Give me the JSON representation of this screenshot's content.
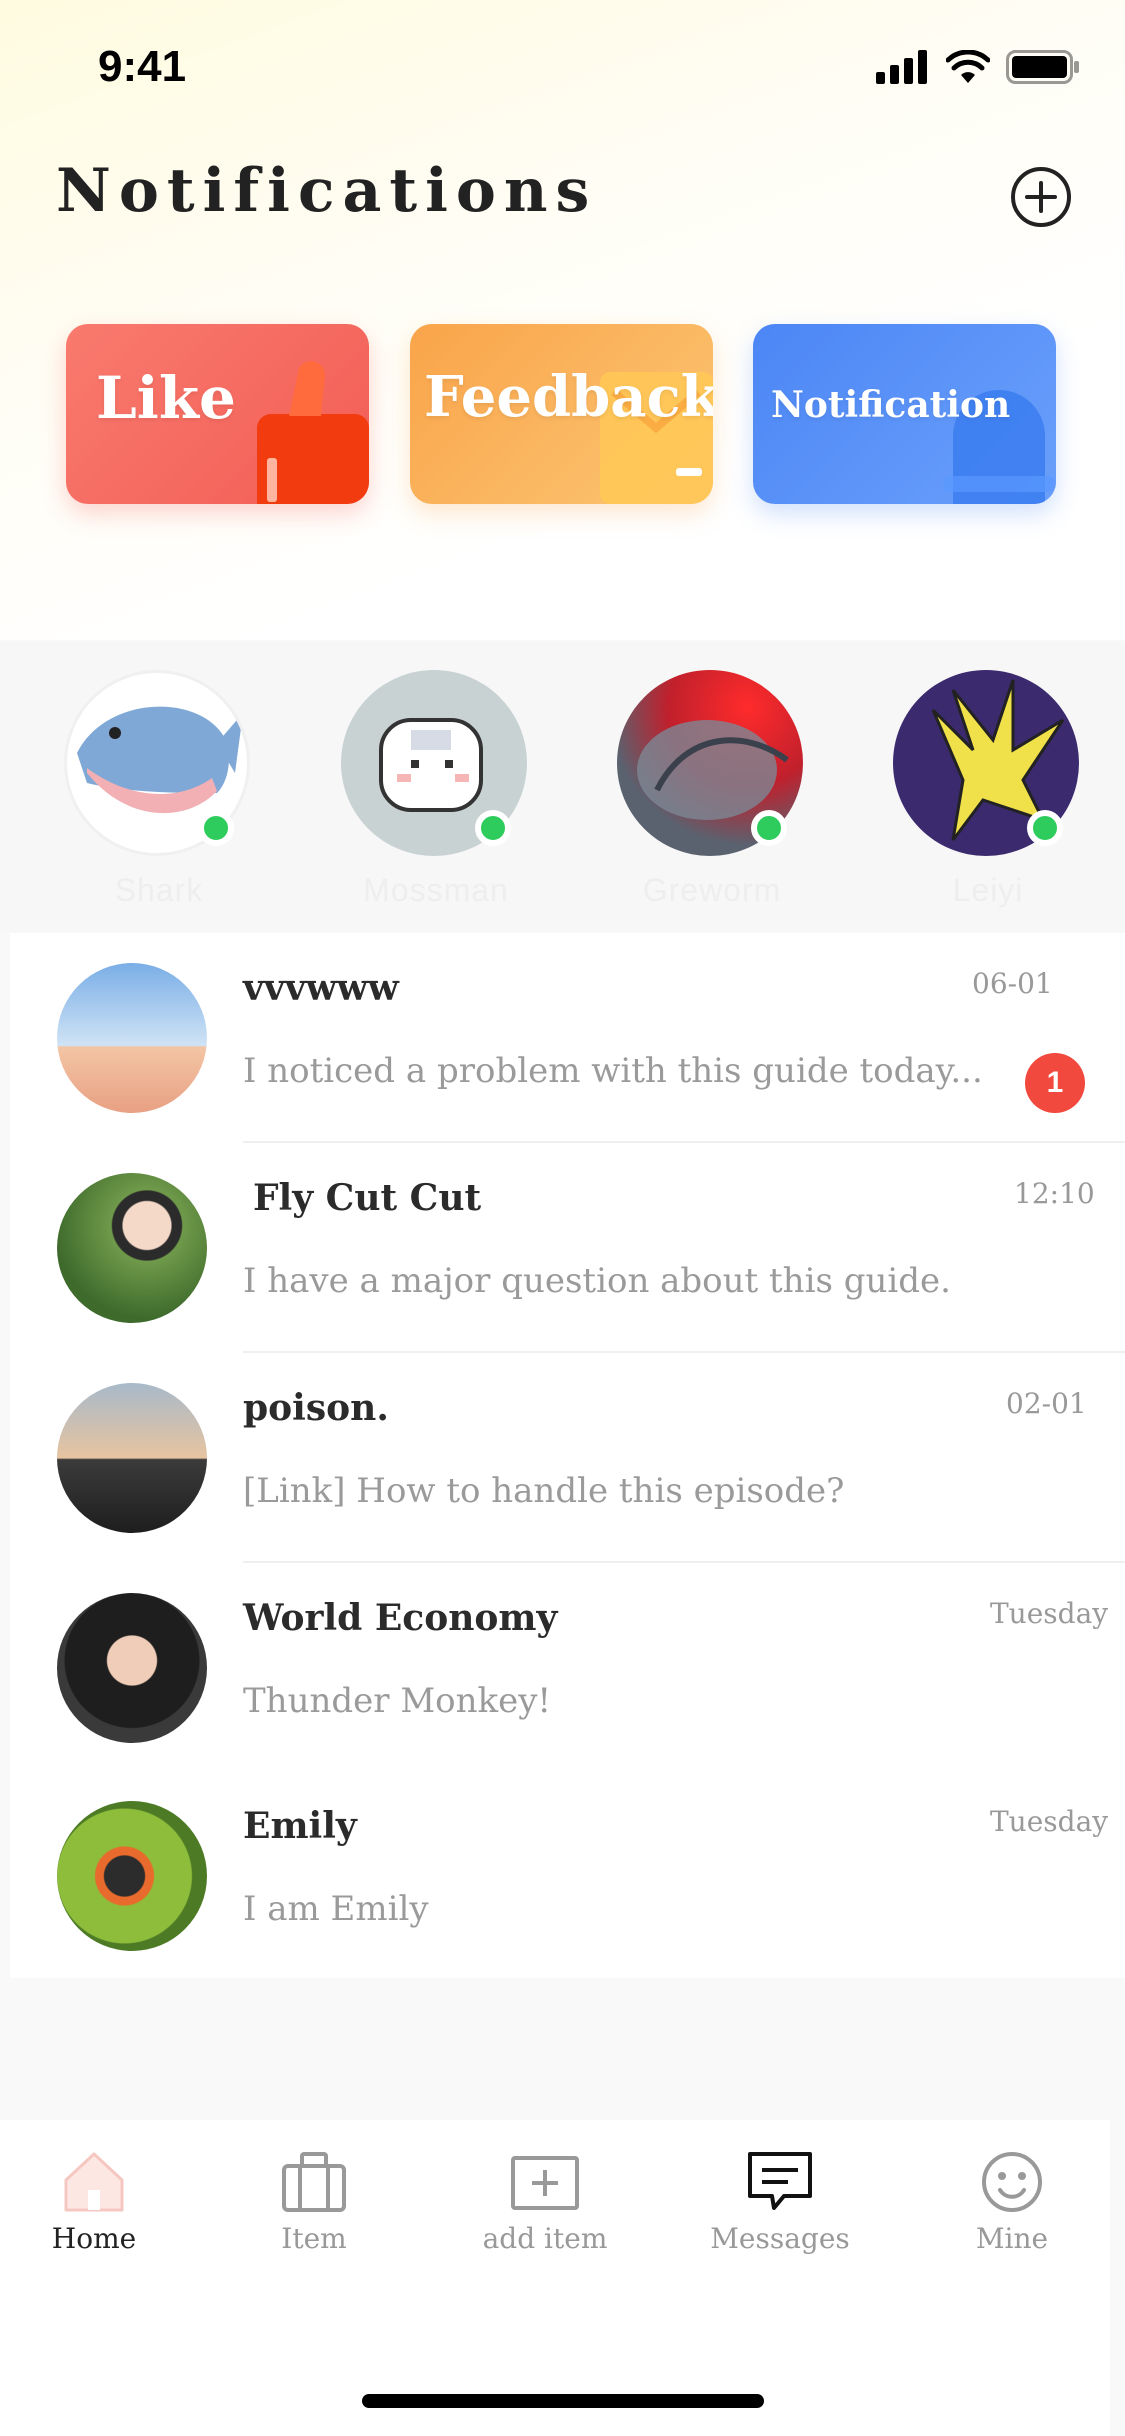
{
  "status": {
    "time": "9:41"
  },
  "header": {
    "title": "Notifications",
    "add_icon": "plus-circle-icon"
  },
  "categories": [
    {
      "label": "Like",
      "icon": "thumbs-up-icon",
      "color": "#f25d55"
    },
    {
      "label": "Feedback",
      "icon": "mail-icon",
      "color": "#f9a44a"
    },
    {
      "label": "Notification",
      "icon": "bell-icon",
      "color": "#4c86f5"
    }
  ],
  "stories": [
    {
      "name": "Shark",
      "online": true
    },
    {
      "name": "Mossman",
      "online": true
    },
    {
      "name": "Greworm",
      "online": true
    },
    {
      "name": "Leiyi",
      "online": true
    }
  ],
  "messages": [
    {
      "name": "vvvwww",
      "time": "06-01",
      "preview": "I noticed a problem with this guide today...",
      "unread": "1"
    },
    {
      "name": "Fly Cut Cut",
      "time": "12:10",
      "preview": "I have a major question about this guide.",
      "unread": ""
    },
    {
      "name": "poison.",
      "time": "02-01",
      "preview": "[Link] How to handle this episode?",
      "unread": ""
    },
    {
      "name": "World Economy",
      "time": "Tuesday",
      "preview": "Thunder Monkey!",
      "unread": ""
    },
    {
      "name": "Emily",
      "time": "Tuesday",
      "preview": "I am Emily",
      "unread": ""
    }
  ],
  "tabs": [
    {
      "label": "Home",
      "icon": "home-icon",
      "active": true
    },
    {
      "label": "Item",
      "icon": "briefcase-icon",
      "active": false
    },
    {
      "label": "add item",
      "icon": "add-box-icon",
      "active": false
    },
    {
      "label": "Messages",
      "icon": "message-icon",
      "active": false
    },
    {
      "label": "Mine",
      "icon": "smiley-icon",
      "active": false
    }
  ],
  "colors": {
    "online": "#2ecc5d",
    "badge": "#f2493f"
  }
}
